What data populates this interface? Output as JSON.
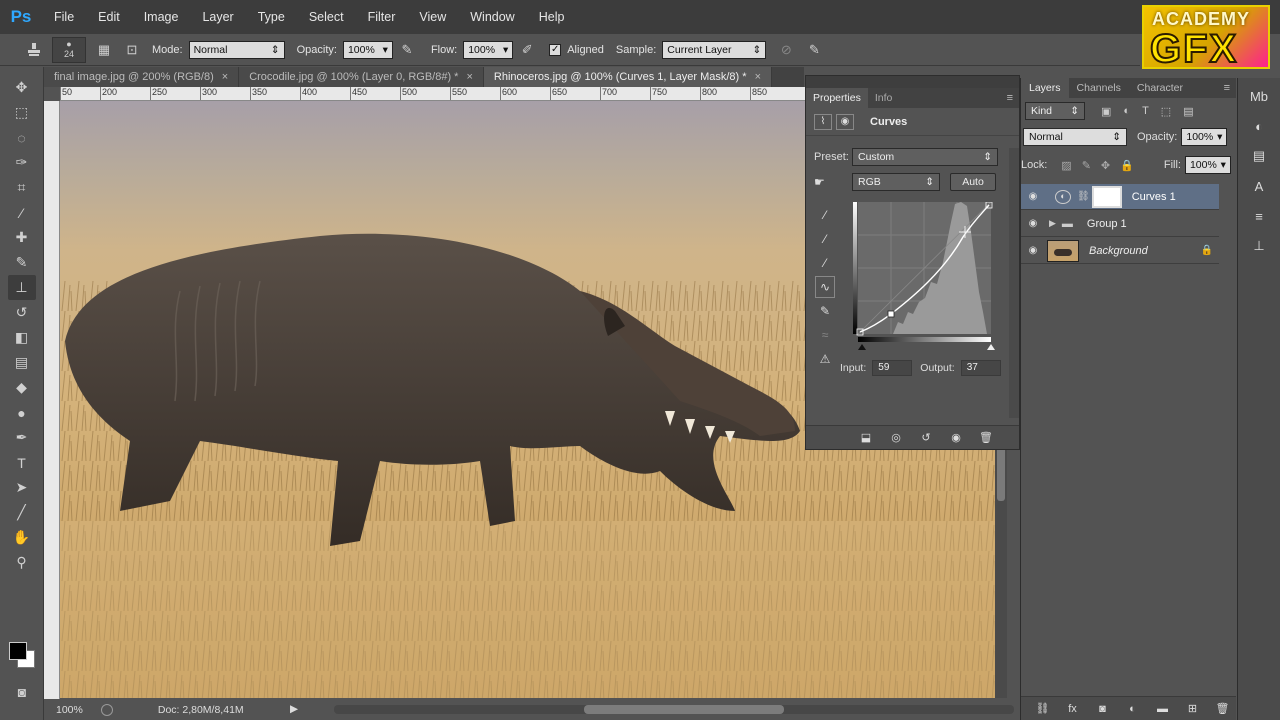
{
  "app": {
    "logo": "Ps"
  },
  "menu": [
    "File",
    "Edit",
    "Image",
    "Layer",
    "Type",
    "Select",
    "Filter",
    "View",
    "Window",
    "Help"
  ],
  "brand_logo": {
    "line1": "ACADEMY",
    "line2": "GFX"
  },
  "options": {
    "brush_size": "24",
    "mode_label": "Mode:",
    "mode_value": "Normal",
    "opacity_label": "Opacity:",
    "opacity_value": "100%",
    "flow_label": "Flow:",
    "flow_value": "100%",
    "aligned_label": "Aligned",
    "aligned_checked": true,
    "sample_label": "Sample:",
    "sample_value": "Current Layer"
  },
  "doc_tabs": [
    {
      "label": "final image.jpg @ 200% (RGB/8)",
      "close": "×"
    },
    {
      "label": "Crocodile.jpg @ 100% (Layer 0, RGB/8#) *",
      "close": "×"
    },
    {
      "label": "Rhinoceros.jpg @ 100% (Curves 1, Layer Mask/8) *",
      "close": "×"
    }
  ],
  "ruler_ticks": [
    "50",
    "200",
    "250",
    "300",
    "350",
    "400",
    "450",
    "500",
    "550",
    "600",
    "650",
    "700",
    "750",
    "800",
    "850"
  ],
  "status": {
    "zoom": "100%",
    "doc": "Doc: 2,80M/8,41M"
  },
  "properties": {
    "tabs": [
      "Properties",
      "Info"
    ],
    "title": "Curves",
    "preset_label": "Preset:",
    "preset_value": "Custom",
    "channel_value": "RGB",
    "auto_label": "Auto",
    "input_label": "Input:",
    "input_value": "59",
    "output_label": "Output:",
    "output_value": "37"
  },
  "layers_panel": {
    "tabs": [
      "Layers",
      "Channels",
      "Character"
    ],
    "kind_label": "Kind",
    "blend_mode": "Normal",
    "opacity_label": "Opacity:",
    "opacity_value": "100%",
    "lock_label": "Lock:",
    "fill_label": "Fill:",
    "fill_value": "100%",
    "layers": [
      {
        "name": "Curves 1",
        "selected": true
      },
      {
        "name": "Group 1",
        "selected": false
      },
      {
        "name": "Background",
        "selected": false
      }
    ]
  },
  "colors": {
    "accent": "#2fa8ff",
    "selected_layer": "#5f6f86",
    "panel_bg": "#535353"
  }
}
